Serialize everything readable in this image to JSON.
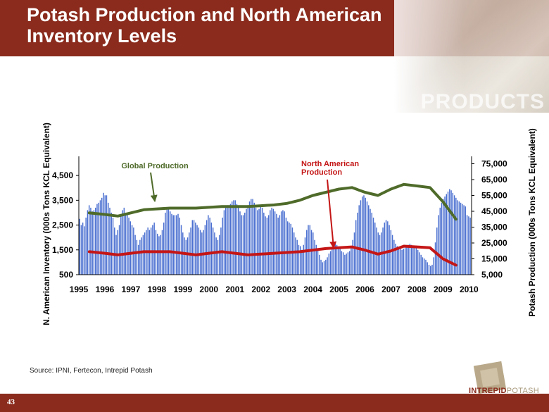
{
  "title": "Potash Production and North American Inventory Levels",
  "source": "Source: IPNI, Fertecon, Intrepid Potash",
  "page_number": "43",
  "logo": {
    "part1": "INTREPID",
    "part2": "POTASH"
  },
  "header_image_word": "PRODUCTS",
  "colors": {
    "brand": "#8a2b1d",
    "bars": "#4a6fd0",
    "global": "#4f6b2a",
    "na": "#c41616"
  },
  "chart_data": {
    "type": "bar",
    "left_axis": {
      "label": "N. American Inventory (000s Tons KCL Equivalent)",
      "ticks": [
        "4,500",
        "3,500",
        "2,500",
        "1,500",
        "500"
      ],
      "ylim": [
        500,
        5100
      ]
    },
    "right_axis": {
      "label": "Potash Production (000s Tons KCL Equivalent)",
      "ticks": [
        "75,000",
        "65,000",
        "55,000",
        "45,000",
        "35,000",
        "25,000",
        "15,000",
        "5,000"
      ],
      "ylim": [
        5000,
        77000
      ]
    },
    "x_ticks": [
      "1995",
      "1996",
      "1997",
      "1998",
      "1999",
      "2000",
      "2001",
      "2002",
      "2003",
      "2004",
      "2005",
      "2006",
      "2007",
      "2008",
      "2009",
      "2010"
    ],
    "x_range": [
      1995.0,
      2010.1
    ],
    "annotations": [
      {
        "text": [
          "Global Production"
        ],
        "color": "#4f6b2a"
      },
      {
        "text": [
          "North American",
          "Production"
        ],
        "color": "#c41616"
      }
    ],
    "bars": [
      {
        "name": "N. American Inventory",
        "x_start": 1995.0,
        "x_end": 2010.08,
        "values": [
          2750,
          2500,
          2600,
          2450,
          2800,
          3100,
          3300,
          3200,
          3050,
          3100,
          3200,
          3350,
          3400,
          3500,
          3600,
          3800,
          3700,
          3700,
          3400,
          3200,
          3000,
          2800,
          2400,
          2100,
          2300,
          2500,
          2900,
          3100,
          3200,
          3000,
          2900,
          2800,
          2650,
          2500,
          2400,
          2100,
          1900,
          1700,
          1900,
          2000,
          2100,
          2200,
          2300,
          2400,
          2300,
          2400,
          2500,
          2600,
          2300,
          2150,
          2050,
          2100,
          2300,
          2600,
          3000,
          3200,
          3150,
          3050,
          2950,
          2900,
          2900,
          2900,
          2950,
          2800,
          2500,
          2200,
          2000,
          1900,
          2000,
          2200,
          2400,
          2700,
          2700,
          2600,
          2500,
          2400,
          2300,
          2200,
          2300,
          2500,
          2700,
          2900,
          2800,
          2600,
          2400,
          2200,
          2000,
          1900,
          2100,
          2400,
          2800,
          3100,
          3200,
          3300,
          3300,
          3350,
          3450,
          3500,
          3500,
          3350,
          3200,
          3050,
          2900,
          2900,
          3000,
          3150,
          3300,
          3450,
          3550,
          3550,
          3400,
          3200,
          3100,
          3150,
          3250,
          3200,
          3000,
          2850,
          2800,
          2900,
          3100,
          3200,
          3150,
          3050,
          2950,
          2800,
          2900,
          3050,
          3100,
          3050,
          2800,
          2650,
          2600,
          2550,
          2400,
          2200,
          2000,
          1900,
          1700,
          1650,
          1500,
          1700,
          2000,
          2300,
          2500,
          2500,
          2300,
          2200,
          1900,
          1700,
          1500,
          1300,
          1100,
          1000,
          1050,
          1100,
          1200,
          1350,
          1450,
          1600,
          1750,
          1800,
          1700,
          1600,
          1550,
          1450,
          1400,
          1300,
          1350,
          1400,
          1450,
          1600,
          1900,
          2200,
          2700,
          3000,
          3300,
          3500,
          3650,
          3700,
          3600,
          3450,
          3300,
          3150,
          3000,
          2800,
          2600,
          2400,
          2200,
          2100,
          2200,
          2400,
          2600,
          2700,
          2650,
          2500,
          2300,
          2100,
          1900,
          1750,
          1650,
          1600,
          1550,
          1500,
          1550,
          1600,
          1650,
          1700,
          1750,
          1700,
          1650,
          1650,
          1600,
          1500,
          1400,
          1300,
          1200,
          1150,
          1100,
          1000,
          900,
          850,
          900,
          1200,
          1800,
          2400,
          2900,
          3200,
          3400,
          3550,
          3650,
          3750,
          3850,
          3950,
          3900,
          3800,
          3700,
          3600,
          3500,
          3450,
          3400,
          3350,
          3300,
          3250,
          2900,
          2850,
          2800
        ]
      }
    ],
    "series": [
      {
        "name": "Global Production",
        "axis": "right",
        "color": "#4f6b2a",
        "x": [
          1995.4,
          1996.0,
          1996.5,
          1997.0,
          1997.5,
          1998.0,
          1998.5,
          1999.0,
          1999.5,
          2000.0,
          2000.5,
          2001.0,
          2001.5,
          2002.0,
          2002.5,
          2003.0,
          2003.5,
          2004.0,
          2004.5,
          2005.0,
          2005.5,
          2006.0,
          2006.5,
          2007.0,
          2007.5,
          2008.0,
          2008.5,
          2009.0,
          2009.5
        ],
        "y": [
          44000,
          43000,
          42000,
          44000,
          46000,
          46500,
          47000,
          47000,
          47000,
          47500,
          48000,
          48000,
          48000,
          48500,
          49000,
          50000,
          52000,
          55000,
          57000,
          59000,
          60000,
          57000,
          55000,
          59000,
          62000,
          61000,
          60000,
          51000,
          40000
        ]
      },
      {
        "name": "North American Production",
        "axis": "right",
        "color": "#c41616",
        "x": [
          1995.4,
          1996.0,
          1996.5,
          1997.0,
          1997.5,
          1998.0,
          1998.5,
          1999.0,
          1999.5,
          2000.0,
          2000.5,
          2001.0,
          2001.5,
          2002.0,
          2002.5,
          2003.0,
          2003.5,
          2004.0,
          2004.5,
          2005.0,
          2005.5,
          2006.0,
          2006.5,
          2007.0,
          2007.5,
          2008.0,
          2008.5,
          2009.0,
          2009.5
        ],
        "y": [
          19500,
          18500,
          17500,
          18500,
          19500,
          19500,
          19500,
          18500,
          17500,
          18500,
          19500,
          18500,
          17500,
          18000,
          18500,
          19000,
          19500,
          20500,
          21500,
          22000,
          22500,
          20500,
          18000,
          20000,
          23000,
          22500,
          22000,
          15000,
          11000
        ]
      }
    ]
  }
}
